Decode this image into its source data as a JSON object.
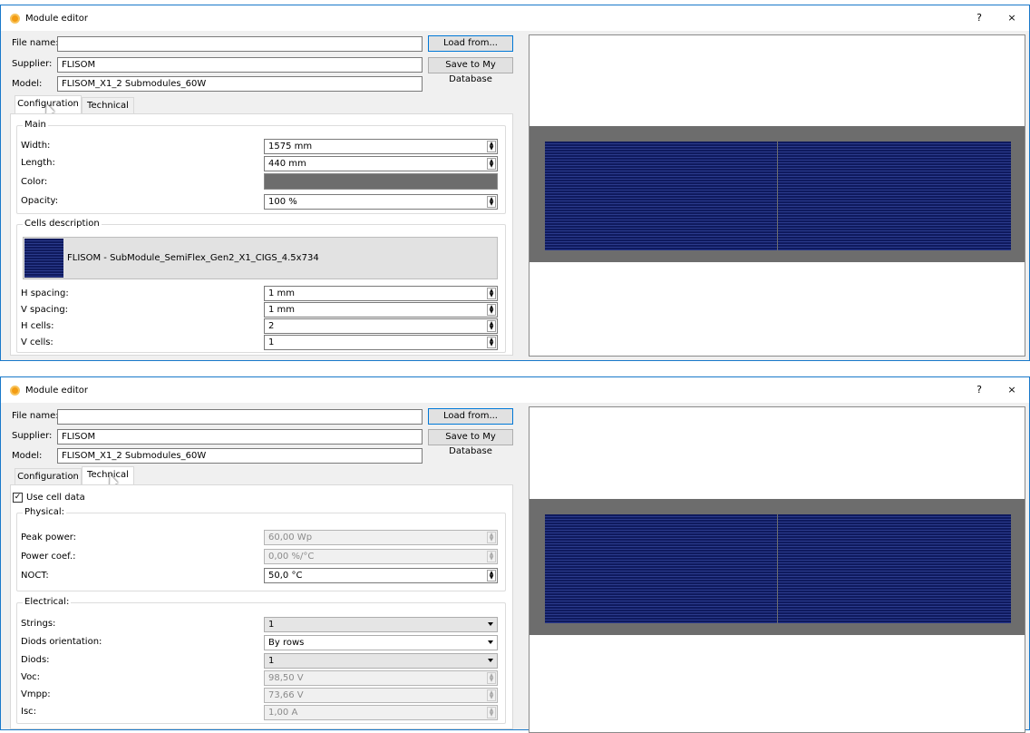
{
  "windows": [
    {
      "title": "Module editor",
      "help": "?",
      "close": "×",
      "file_name_label": "File name:",
      "file_name_value": "",
      "load_button": "Load from...",
      "supplier_label": "Supplier:",
      "supplier_value": "FLISOM",
      "save_button": "Save to My Database",
      "model_label": "Model:",
      "model_value": "FLISOM_X1_2 Submodules_60W",
      "tabs": [
        "Configuration",
        "Technical"
      ],
      "active_tab": "Configuration",
      "main_group": {
        "title": "Main",
        "rows": [
          {
            "label": "Width:",
            "value": "1575 mm"
          },
          {
            "label": "Length:",
            "value": "440 mm"
          },
          {
            "label": "Color:",
            "value": ""
          },
          {
            "label": "Opacity:",
            "value": "100 %"
          }
        ]
      },
      "cells_group": {
        "title": "Cells description",
        "cell_name": "FLISOM - SubModule_SemiFlex_Gen2_X1_CIGS_4.5x734",
        "rows": [
          {
            "label": "H spacing:",
            "value": "1 mm"
          },
          {
            "label": "V spacing:",
            "value": "1 mm"
          },
          {
            "label": "H cells:",
            "value": "2"
          },
          {
            "label": "V cells:",
            "value": "1"
          }
        ]
      }
    },
    {
      "title": "Module editor",
      "help": "?",
      "close": "×",
      "file_name_label": "File name:",
      "file_name_value": "",
      "load_button": "Load from...",
      "supplier_label": "Supplier:",
      "supplier_value": "FLISOM",
      "save_button": "Save to My Database",
      "model_label": "Model:",
      "model_value": "FLISOM_X1_2 Submodules_60W",
      "tabs": [
        "Configuration",
        "Technical"
      ],
      "active_tab": "Technical",
      "use_cell_data": {
        "label": "Use cell data",
        "checked": true
      },
      "physical_group": {
        "title": "Physical:",
        "rows": [
          {
            "label": "Peak power:",
            "value": "60,00 Wp",
            "enabled": false
          },
          {
            "label": "Power coef.:",
            "value": "0,00 %/°C",
            "enabled": false
          },
          {
            "label": "NOCT:",
            "value": "50,0 °C",
            "enabled": true
          }
        ]
      },
      "electrical_group": {
        "title": "Electrical:",
        "rows": [
          {
            "label": "Strings:",
            "value": "1",
            "kind": "combo"
          },
          {
            "label": "Diods orientation:",
            "value": "By rows",
            "kind": "combo-white"
          },
          {
            "label": "Diods:",
            "value": "1",
            "kind": "combo"
          },
          {
            "label": "Voc:",
            "value": "98,50 V",
            "kind": "spin-dis"
          },
          {
            "label": "Vmpp:",
            "value": "73,66 V",
            "kind": "spin-dis"
          },
          {
            "label": "Isc:",
            "value": "1,00 A",
            "kind": "spin-dis"
          }
        ]
      }
    }
  ],
  "colors": {
    "cell_blue": "#0f1a5e",
    "frame_gray": "#6d6d6d",
    "accent": "#0078d7"
  }
}
